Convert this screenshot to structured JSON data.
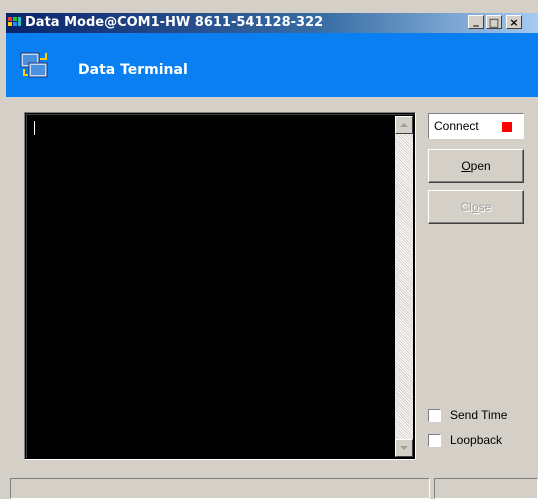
{
  "window": {
    "title": "Data Mode@COM1-HW 8611-541128-322",
    "app_icon": "app-grid-icon",
    "caption_buttons": {
      "minimize": "_",
      "maximize": "□",
      "close": "×"
    }
  },
  "header": {
    "title": "Data Terminal",
    "icon": "data-transfer-icon"
  },
  "terminal": {
    "content": ""
  },
  "connection": {
    "label": "Connect",
    "indicator_color": "#ff0000"
  },
  "buttons": {
    "open_prefix": "",
    "open_mnemonic": "O",
    "open_suffix": "pen",
    "close_prefix": "Cl",
    "close_mnemonic": "o",
    "close_suffix": "se"
  },
  "options": {
    "send_time": "Send Time",
    "loopback": "Loopback"
  },
  "status": {
    "pane1": "",
    "pane2": ""
  },
  "colors": {
    "header_bg": "#0a7ff2",
    "window_bg": "#d4d0c8",
    "terminal_bg": "#000000"
  }
}
